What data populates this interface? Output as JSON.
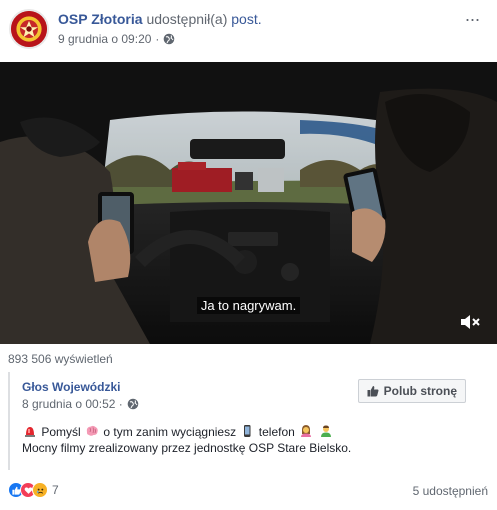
{
  "post": {
    "page_name": "OSP Złotoria",
    "shared_text": "udostępnił(a)",
    "post_link": "post.",
    "date": "9 grudnia o 09:20",
    "more_label": "···"
  },
  "video": {
    "subtitle": "Ja to nagrywam."
  },
  "views": "893 506 wyświetleń",
  "shared_post": {
    "page_name": "Głos Wojewódzki",
    "date": "8 grudnia o 00:52 ·",
    "like_button_label": "Polub stronę",
    "line1_parts": [
      "Pomyśl",
      "o tym zanim wyciągniesz",
      "telefon"
    ],
    "line2": "Mocny filmy zrealizowany przez jednostkę OSP Stare Bielsko."
  },
  "footer": {
    "reaction_count": "7",
    "share_count": "5 udostępnień"
  },
  "colors": {
    "link": "#385898",
    "secondary_text": "#606770",
    "like_blue": "#1877f2",
    "love_red": "#f33e58",
    "haha_yellow": "#f7b125"
  }
}
